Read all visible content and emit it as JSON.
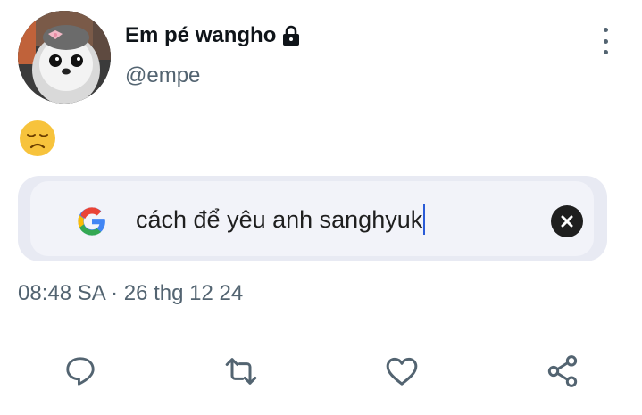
{
  "author": {
    "display_name": "Em pé wangho",
    "handle": "@empe",
    "avatar_icon": "penguin-with-bow-avatar",
    "protected_icon": "lock-icon"
  },
  "menu_icon": "more-vertical-icon",
  "tweet": {
    "emoji": "😞",
    "search_card": {
      "logo_icon": "google-logo-icon",
      "query": "cách để yêu anh sanghyuk",
      "clear_icon": "clear-icon"
    },
    "timestamp": "08:48 SA · 26 thg 12 24"
  },
  "actions": [
    {
      "icon": "reply-icon"
    },
    {
      "icon": "retweet-icon"
    },
    {
      "icon": "like-icon"
    },
    {
      "icon": "share-icon"
    }
  ],
  "colors": {
    "text_primary": "#0f1419",
    "text_secondary": "#536471",
    "search_bg": "#e8eaf3",
    "caret": "#2a5bd7"
  }
}
